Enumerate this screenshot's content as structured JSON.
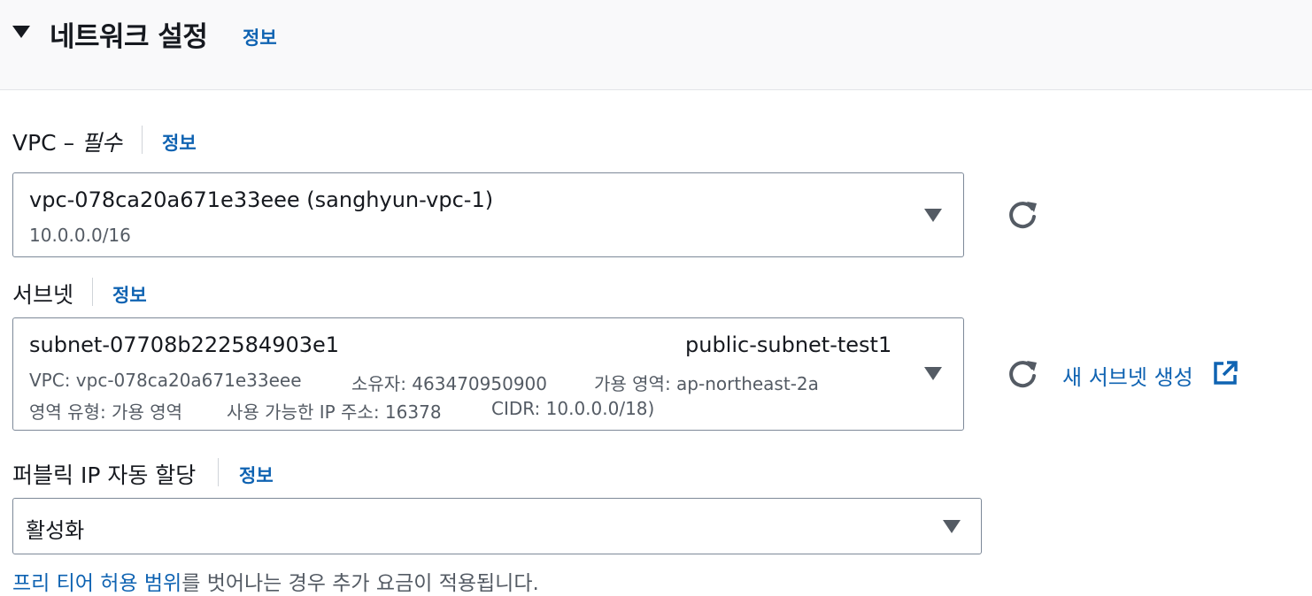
{
  "section": {
    "title": "네트워크 설정",
    "info": "정보"
  },
  "vpc": {
    "label": "VPC – ",
    "required": "필수",
    "info": "정보",
    "value": "vpc-078ca20a671e33eee (sanghyun-vpc-1)",
    "cidr": "10.0.0.0/16"
  },
  "subnet": {
    "label": "서브넷",
    "info": "정보",
    "id": "subnet-07708b222584903e1",
    "name": "public-subnet-test1",
    "vpc_text": "VPC: vpc-078ca20a671e33eee",
    "owner_text": "소유자: 463470950900",
    "az_text": "가용 영역: ap-northeast-2a",
    "zone_type_text": "영역 유형: 가용 영역",
    "ip_count_text": "사용 가능한 IP 주소: 16378",
    "cidr_text": "CIDR: 10.0.0.0/18)",
    "create_label": "새 서브넷 생성"
  },
  "public_ip": {
    "label": "퍼블릭 IP 자동 할당",
    "info": "정보",
    "value": "활성화"
  },
  "footnote": {
    "link": "프리 티어 허용 범위",
    "text": "를 벗어나는 경우 추가 요금이 적용됩니다."
  },
  "icons": {
    "collapse": "caret-down-icon",
    "dropdown": "triangle-down-icon",
    "refresh": "refresh-icon",
    "external": "external-link-icon"
  },
  "colors": {
    "link": "#0f63b2",
    "text": "#16191f",
    "secondary": "#545b64",
    "border": "#7d8998",
    "header_bg": "#f9f9fa"
  }
}
